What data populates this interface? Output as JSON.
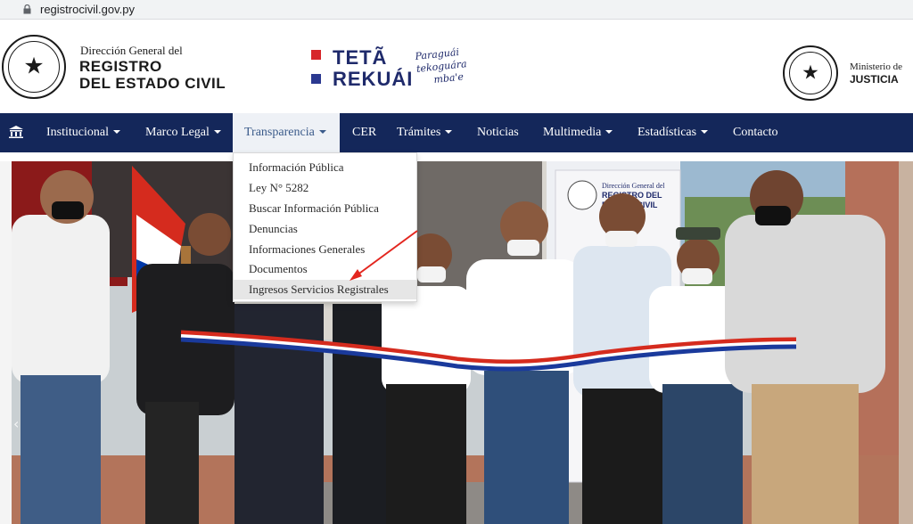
{
  "browser": {
    "url": "registrocivil.gov.py"
  },
  "header": {
    "left_seal_label": "REPÚBLICA DEL PARAGUAY",
    "agency_small": "Dirección General del",
    "agency_line1": "REGISTRO",
    "agency_line2": "DEL ESTADO CIVIL",
    "brand_line1": "TETÃ",
    "brand_line2": "REKUÁI",
    "slogan": [
      "Paraguái",
      "tekoguára",
      "mba'e"
    ],
    "ministry_small": "Ministerio de",
    "ministry_big": "JUSTICIA"
  },
  "nav": {
    "items": [
      {
        "label": "Institucional",
        "caret": true
      },
      {
        "label": "Marco Legal",
        "caret": true
      },
      {
        "label": "Transparencia",
        "caret": true,
        "active": true
      },
      {
        "label": "CER",
        "caret": false
      },
      {
        "label": "Trámites",
        "caret": true
      },
      {
        "label": "Noticias",
        "caret": false
      },
      {
        "label": "Multimedia",
        "caret": true
      },
      {
        "label": "Estadísticas",
        "caret": true
      },
      {
        "label": "Contacto",
        "caret": false
      }
    ]
  },
  "dropdown": {
    "items": [
      "Información Pública",
      "Ley N° 5282",
      "Buscar Información Pública",
      "Denuncias",
      "Informaciones Generales",
      "Documentos",
      "Ingresos Servicios Registrales"
    ],
    "highlighted_index": 6
  },
  "hero": {
    "banner_line1": "Dirección General del",
    "banner_line2": "REGISTRO DEL",
    "banner_line3": "ESTADO CIVIL"
  },
  "colors": {
    "nav_bg": "#14275a",
    "brand_red": "#d7262a",
    "brand_blue": "#2b3990",
    "annotation_arrow": "#e3261f"
  }
}
